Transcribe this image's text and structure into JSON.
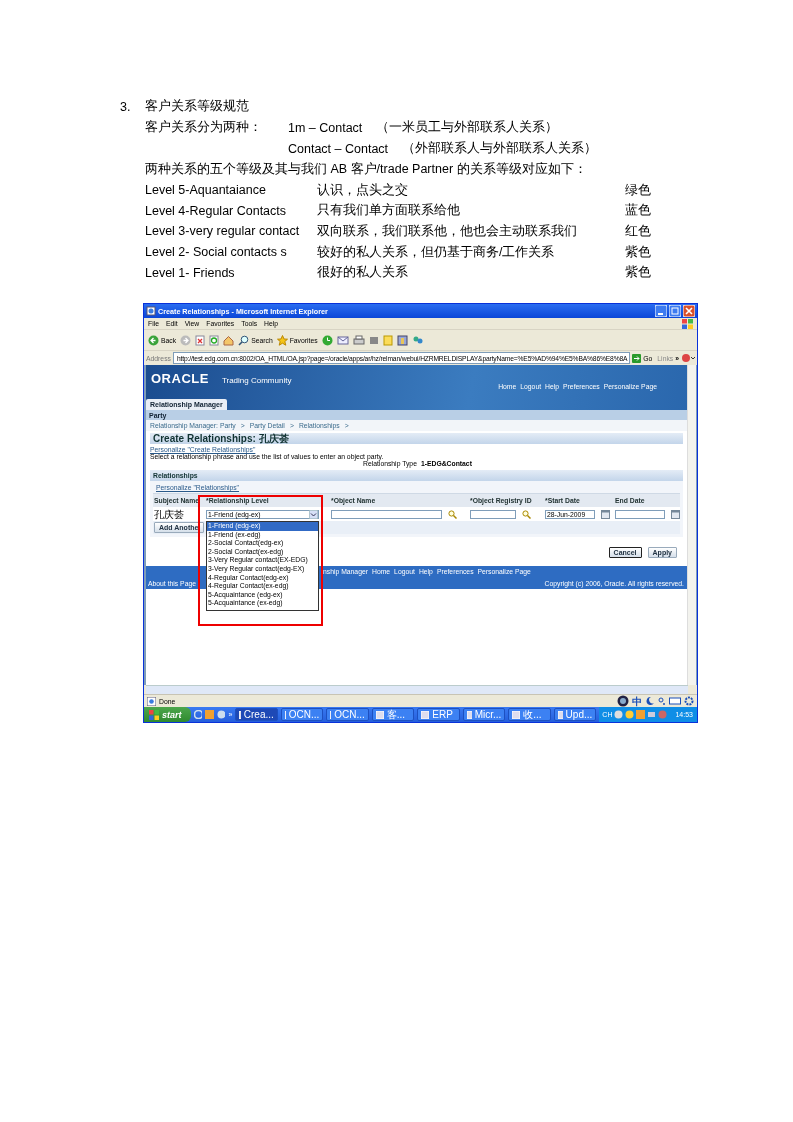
{
  "document": {
    "section_number": "3.",
    "heading": "客户关系等级规范",
    "intro_label": "客户关系分为两种：",
    "relation_types": [
      {
        "name": "1m – Contact",
        "note": "（一米员工与外部联系人关系）"
      },
      {
        "name": "Contact – Contact",
        "note": "（外部联系人与外部联系人关系）"
      }
    ],
    "mapping_sentence": "两种关系的五个等级及其与我们 AB 客户/trade Partner 的关系等级对应如下：",
    "levels": [
      {
        "level": "Level 5-Aquantaiance",
        "description": "认识，点头之交",
        "color_name": "绿色"
      },
      {
        "level": "Level 4-Regular Contacts",
        "description": "只有我们单方面联系给他",
        "color_name": "蓝色"
      },
      {
        "level": "Level 3-very regular contact",
        "description": "双向联系，我们联系他，他也会主动联系我们",
        "color_name": "红色"
      },
      {
        "level": "Level 2- Social contacts s",
        "description": "较好的私人关系，但仍基于商务/工作关系",
        "color_name": "紫色"
      },
      {
        "level": "Level 1- Friends",
        "description": "很好的私人关系",
        "color_name": "紫色"
      }
    ]
  },
  "window": {
    "title": "Create Relationships - Microsoft Internet Explorer"
  },
  "menu": [
    "File",
    "Edit",
    "View",
    "Favorites",
    "Tools",
    "Help"
  ],
  "toolbar": {
    "back": "Back",
    "search": "Search",
    "favorites": "Favorites"
  },
  "address": {
    "label": "Address",
    "url": "http://test.edg.com.cn:8002/OA_HTML/OA.jsp?page=/oracle/apps/ar/hz/relman/webui/HZRMRELDISPLAY&partyName=%E5%AD%94%E5%BA%86%E8%8A",
    "go": "Go",
    "links": "Links",
    "more": "»"
  },
  "app": {
    "logo": "ORACLE",
    "product": "Trading Community",
    "global_links": [
      "Home",
      "Logout",
      "Help",
      "Preferences",
      "Personalize Page"
    ],
    "tabs": [
      {
        "label": "Relationship Manager",
        "selected": true
      }
    ],
    "subtab_bar": "Party",
    "breadcrumbs": [
      {
        "label": "Relationship Manager: Party",
        "separator": ">"
      },
      {
        "label": "Party Detail",
        "separator": ">"
      },
      {
        "label": "Relationships",
        "separator": ">"
      }
    ],
    "page_header": "Create Relationships: 孔庆荟",
    "personalize_link": "Personalize \"Create Relationships\"",
    "instruction": "Select a relationship phrase and use the list of values to enter an object party.",
    "relationship_type": {
      "label": "Relationship Type",
      "value": "1-EDG&Contact"
    },
    "relationships": {
      "header": "Relationships",
      "personalize_link": "Personalize \"Relationships\"",
      "columns": [
        "Subject Name",
        "*Relationship Level",
        "*Object Name",
        "*Object Registry ID",
        "*Start Date",
        "End Date"
      ],
      "rows": [
        {
          "subject_name": "孔庆荟",
          "relationship_level": "1-Friend (edg-ex)",
          "start_date": "28-Jun-2009"
        }
      ],
      "add_button": "Add Anothe"
    },
    "dropdown": [
      {
        "label": "1-Friend (edg-ex)",
        "selected": true
      },
      {
        "label": "1-Friend (ex-edg)",
        "selected": false
      },
      {
        "label": "2-Social Contact(edg-ex)",
        "selected": false
      },
      {
        "label": "2-Social Contact(ex-edg)",
        "selected": false
      },
      {
        "label": "3-Very Regular contact(EX-EDG)",
        "selected": false
      },
      {
        "label": "3-Very Regular contact(edg-EX)",
        "selected": false
      },
      {
        "label": "4-Regular Contact(edg-ex)",
        "selected": false
      },
      {
        "label": "4-Regular Contact(ex-edg)",
        "selected": false
      },
      {
        "label": "5-Acquaintance (edg-ex)",
        "selected": false
      },
      {
        "label": "5-Acquaintance (ex-edg)",
        "selected": false
      }
    ],
    "buttons": [
      "Cancel",
      "Apply"
    ],
    "footer": {
      "links": [
        "nship Manager",
        "Home",
        "Logout",
        "Help",
        "Preferences",
        "Personalize Page"
      ],
      "about": "About this Page",
      "copyright": "Copyright (c) 2006, Oracle. All rights reserved."
    }
  },
  "status_bar": {
    "text": "Done",
    "ime": "中"
  },
  "taskbar": {
    "start": "start",
    "more": "»",
    "tasks": [
      {
        "label": "Crea...",
        "selected": true
      },
      {
        "label": "OCN...",
        "selected": false
      },
      {
        "label": "OCN...",
        "selected": false
      },
      {
        "label": "客...",
        "selected": false
      },
      {
        "label": "ERP",
        "selected": false
      },
      {
        "label": "Micr...",
        "selected": false
      },
      {
        "label": "收...",
        "selected": false
      },
      {
        "label": "Upd...",
        "selected": false
      }
    ],
    "language": "CH",
    "clock": "14:53"
  }
}
